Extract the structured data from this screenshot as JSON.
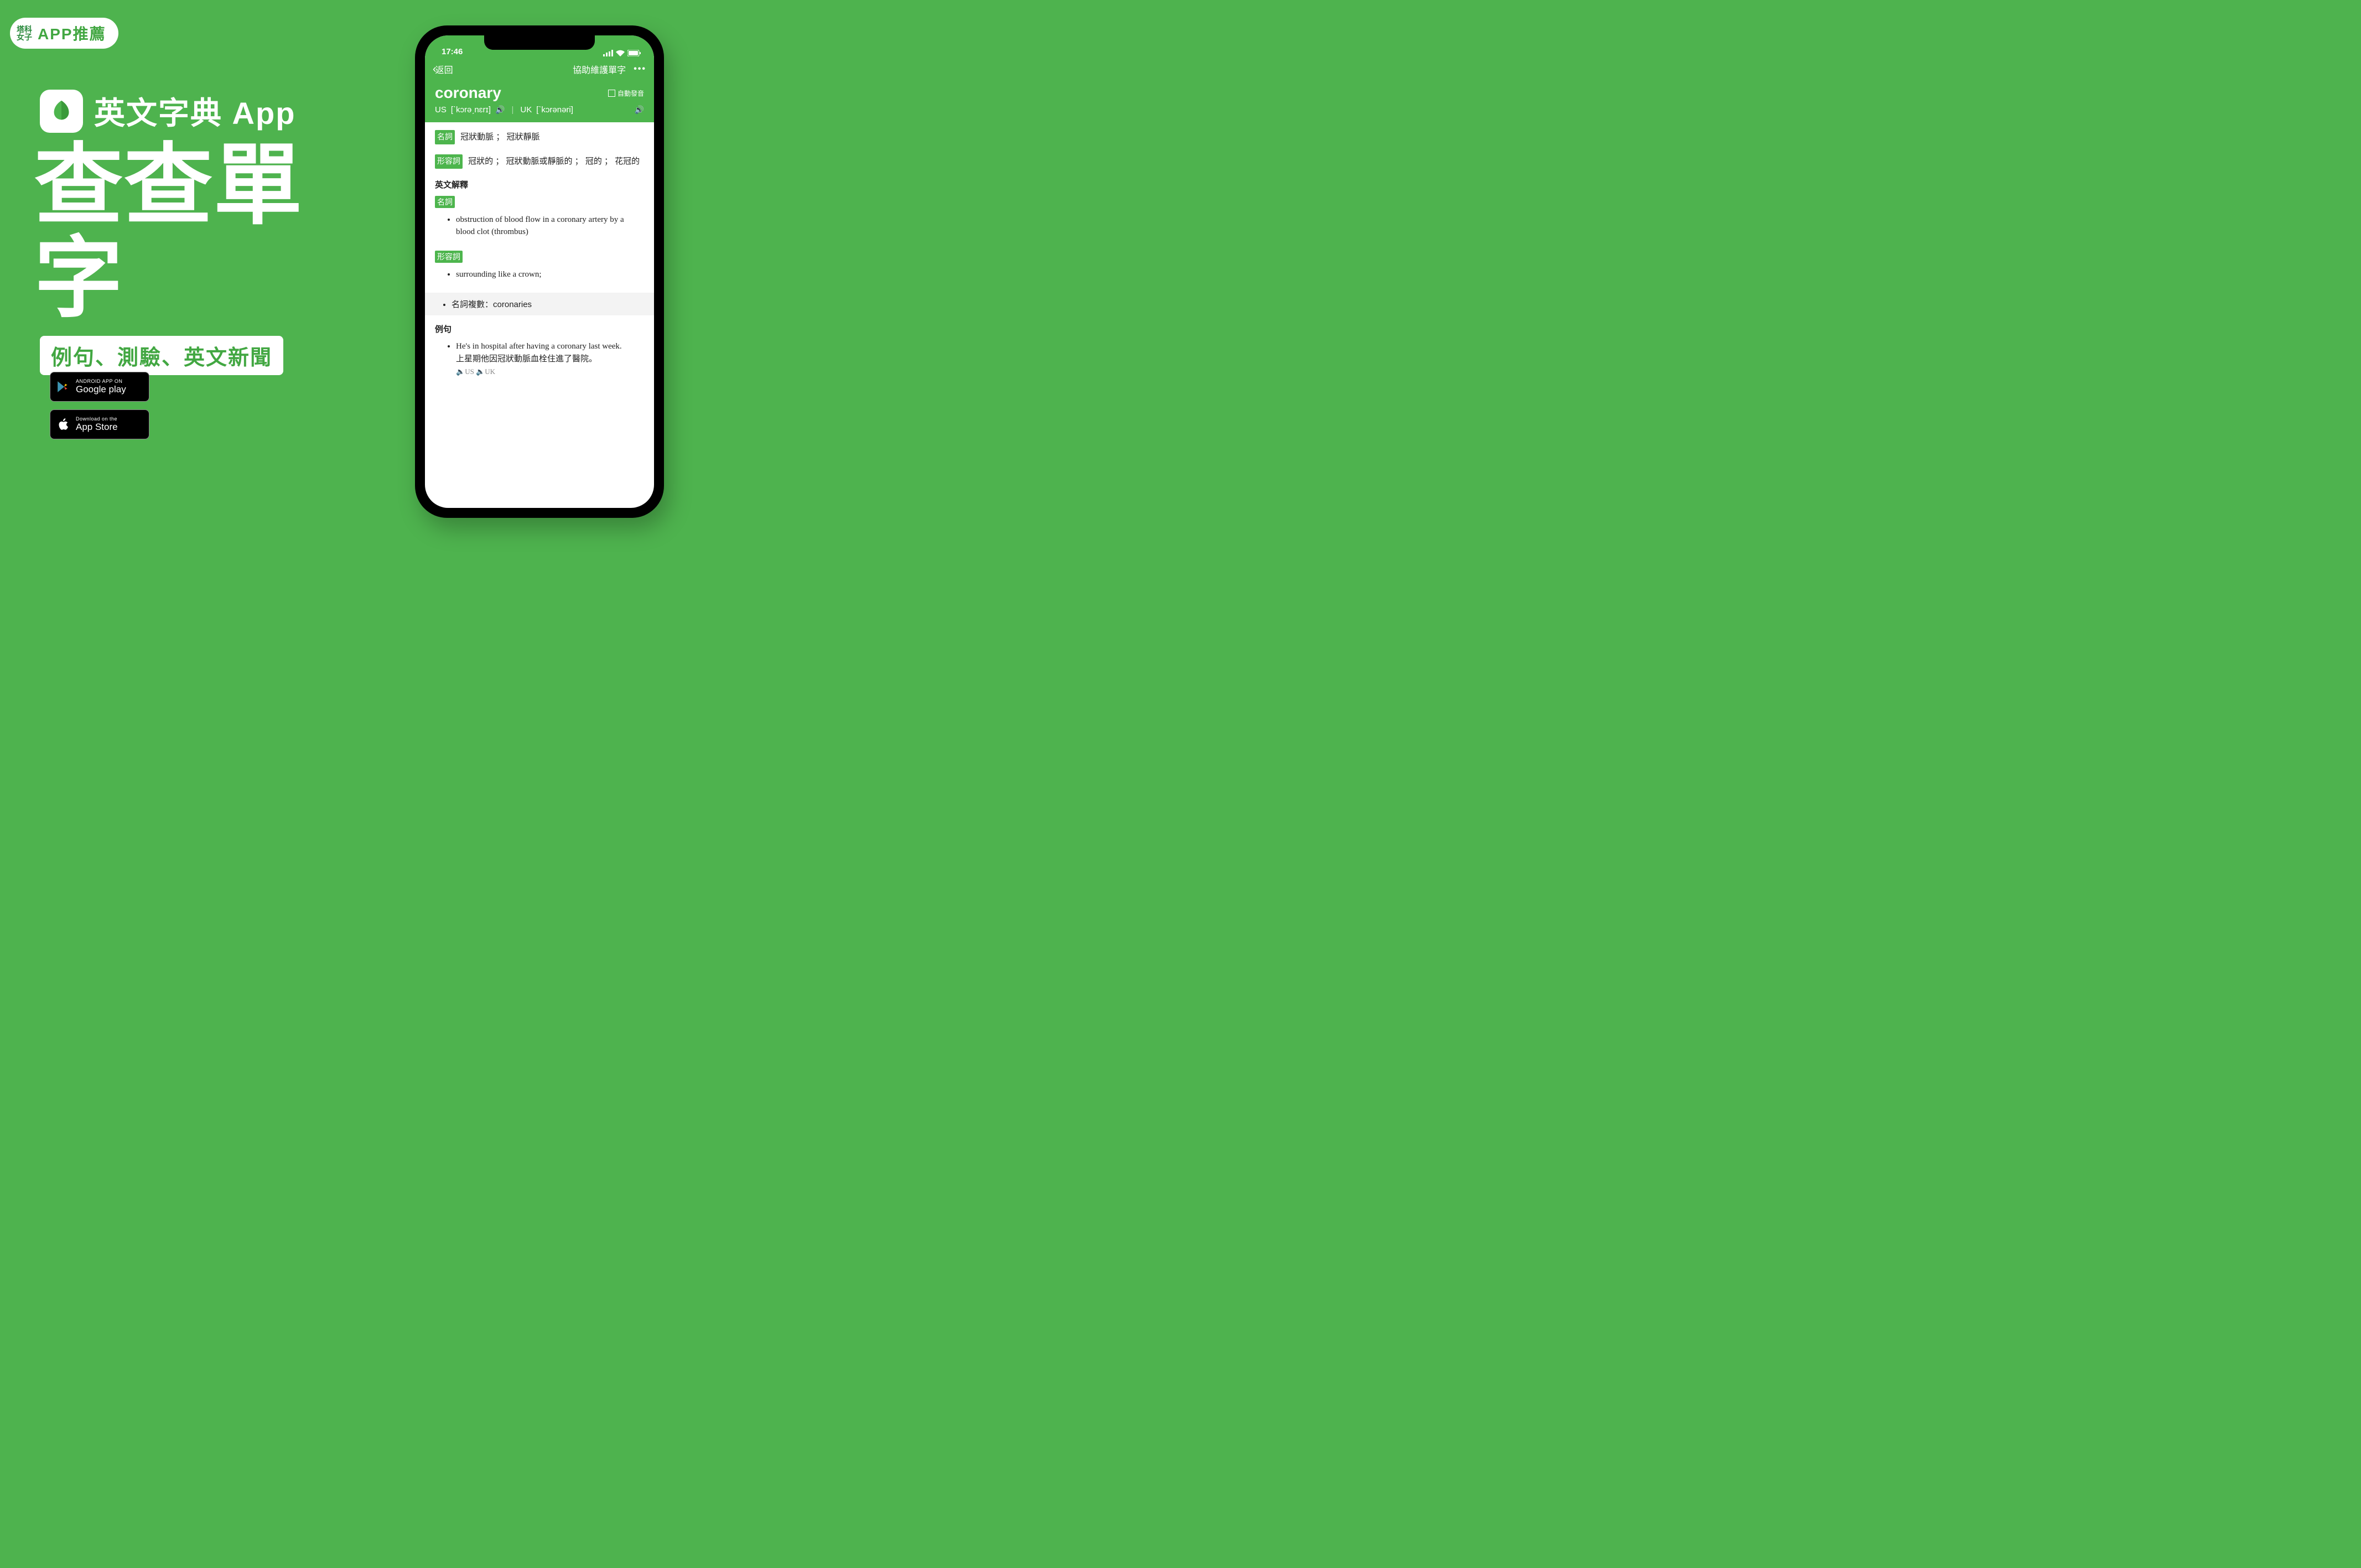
{
  "banner": {
    "brand_top": "塔科",
    "brand_bottom": "女子",
    "pill_label": "APP推薦",
    "title": "英文字典 App",
    "big_text": "查查單字",
    "subtitle": "例句、測驗、英文新聞"
  },
  "stores": {
    "google_small": "ANDROID APP ON",
    "google_big": "Google play",
    "apple_small": "Download on the",
    "apple_big": "App Store"
  },
  "phone": {
    "status_time": "17:46",
    "nav_back": "返回",
    "nav_title": "協助維護單字",
    "word": "coronary",
    "autoplay": "自動發音",
    "pron_us_label": "US",
    "pron_us": "[ˋkɔrəˏnɛrɪ]",
    "pron_uk_label": "UK",
    "pron_uk": "[ˋkɔrənəri]",
    "pos_noun": "名詞",
    "def_noun": "冠狀動脈 ； 冠狀靜脈",
    "pos_adj": "形容詞",
    "def_adj": "冠狀的 ； 冠狀動脈或靜脈的 ； 冠的 ； 花冠的",
    "eng_def_title": "英文解釋",
    "eng_noun_def": "obstruction of blood flow in a coronary artery by a blood clot (thrombus)",
    "eng_adj_def": "surrounding like a crown;",
    "plural_label": "名詞複數：",
    "plural_value": "coronaries",
    "examples_title": "例句",
    "example_en": "He's in hospital after having a coronary last week.",
    "example_zh": "上星期他因冠狀動脈血栓住進了醫院。",
    "speak_us": "US",
    "speak_uk": "UK"
  }
}
